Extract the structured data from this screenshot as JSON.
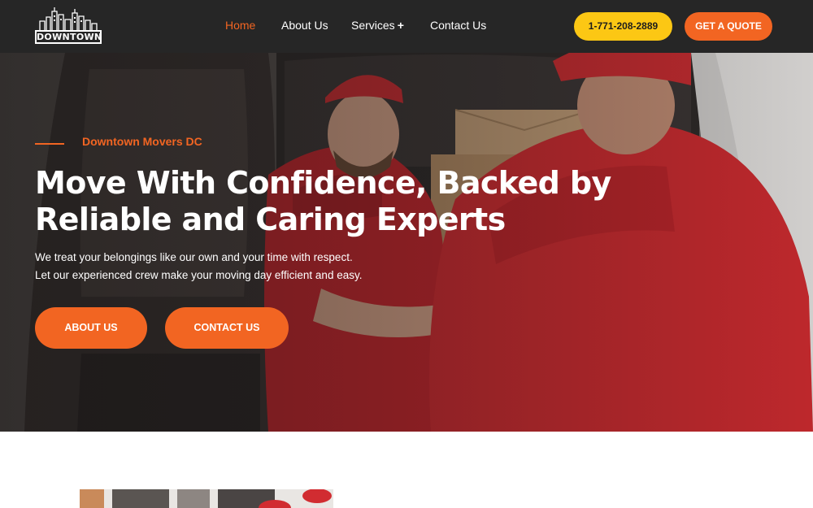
{
  "header": {
    "logo_text": "DOWNTOWN",
    "nav": {
      "home": "Home",
      "about": "About Us",
      "services": "Services",
      "contact": "Contact Us"
    },
    "phone": "1-771-208-2889",
    "quote": "GET A QUOTE"
  },
  "hero": {
    "eyebrow": "Downtown Movers DC",
    "headline": "Move With Confidence, Backed by Reliable and Caring Experts",
    "sub_line1": "We treat your belongings like our own and your time with respect.",
    "sub_line2": "Let our experienced crew make your moving day efficient and easy.",
    "btn_about": "ABOUT US",
    "btn_contact": "CONTACT US"
  },
  "colors": {
    "accent": "#f26522",
    "phone_button": "#fcc714",
    "header_bg": "#262626"
  },
  "icons": {
    "services_expand": "plus-icon",
    "logo": "city-skyline-icon"
  }
}
